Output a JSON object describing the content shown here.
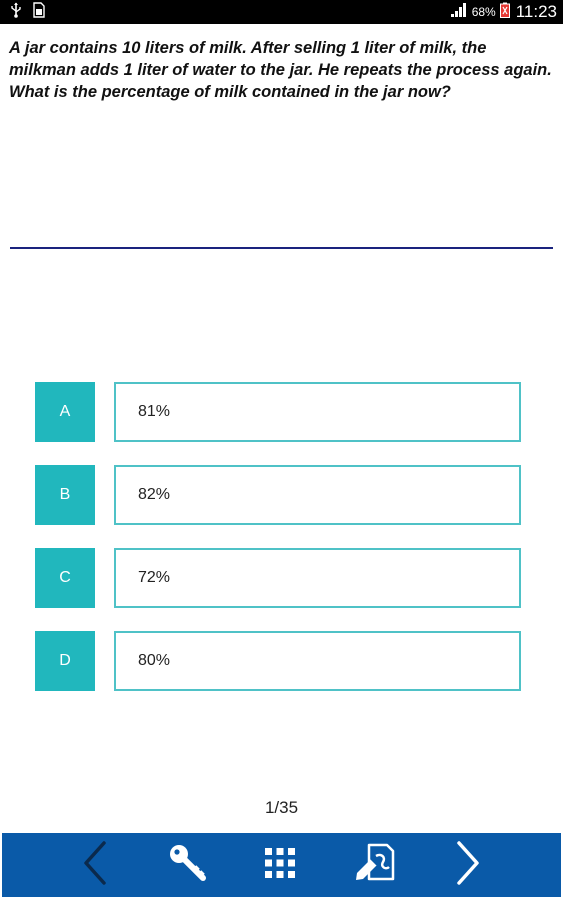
{
  "status_bar": {
    "left_icons": [
      "usb-icon",
      "sim-card-icon"
    ],
    "signal_icon": "signal-icon",
    "battery_percent": "68%",
    "battery_icon": "battery-icon",
    "time": "11:23"
  },
  "question": {
    "text": "A jar contains 10 liters of milk. After selling 1 liter of milk, the milkman adds 1 liter of water to the jar. He repeats the process again. What is the percentage of milk contained in the jar now?"
  },
  "options": [
    {
      "letter": "A",
      "value": "81%"
    },
    {
      "letter": "B",
      "value": "82%"
    },
    {
      "letter": "C",
      "value": "72%"
    },
    {
      "letter": "D",
      "value": "80%"
    }
  ],
  "pagination": {
    "text": "1/35"
  },
  "bottom_nav": {
    "icons": [
      "chevron-left-icon",
      "key-icon",
      "grid-icon",
      "edit-note-icon",
      "chevron-right-icon"
    ],
    "background_color": "#0a5aa8"
  },
  "colors": {
    "accent": "#21b7bd",
    "option_border": "#4fc2c7",
    "divider": "#1a237e"
  }
}
